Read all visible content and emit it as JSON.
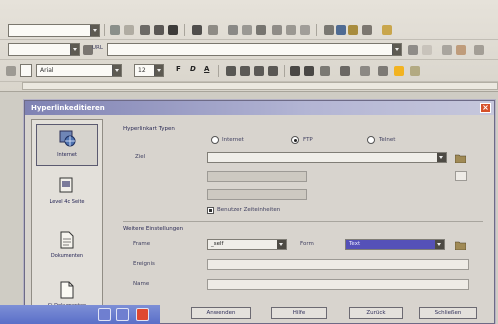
{
  "toolbar": {
    "font_name": "Arial",
    "font_size": "12",
    "bold": "F",
    "italic": "D",
    "underline": "A",
    "url_label": "URL"
  },
  "dialog": {
    "title": "Hyperlinkeditieren",
    "sidebar": {
      "items": [
        {
          "label": "Internet",
          "icon": "globe-icon"
        },
        {
          "label": "Level 4c Seite",
          "icon": "mail-icon"
        },
        {
          "label": "Dokumenten",
          "icon": "document-icon"
        },
        {
          "label": "Ci Dokumenten",
          "icon": "new-document-icon"
        }
      ]
    },
    "group1": {
      "title": "Hyperlinkart Typen",
      "radio_internet": "Internet",
      "radio_ftp": "FTP",
      "radio_telnet": "Telnet",
      "url_label": "Ziel",
      "checkbox_label": "Benutzer Zeiteinheiten"
    },
    "group2": {
      "title": "Weitere Einstellungen",
      "frame_label": "Frame",
      "frame_value": "_self",
      "form_label": "Form",
      "form_value": "Text",
      "events_label": "Ereignis",
      "name_label": "Name"
    },
    "buttons": {
      "apply": "Anwenden",
      "close": "Hilfe",
      "help": "Zurück",
      "reset": "Schließen"
    }
  },
  "taskbar": {
    "item": ""
  }
}
